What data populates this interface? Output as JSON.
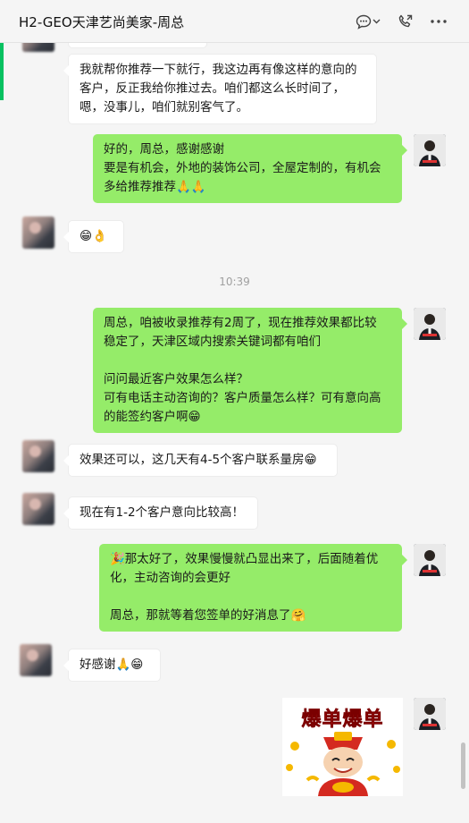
{
  "window": {
    "title": "H2-GEO天津艺尚美家-周总"
  },
  "timestamps": [
    "10:39"
  ],
  "messages": [
    {
      "id": "m1",
      "side": "in",
      "text": "我就帮你推荐一下就行，我这边再有像这样的意向的\n客户，反正我给你推过去。咱们都这么长时间了，\n嗯，没事儿，咱们就别客气了。"
    },
    {
      "id": "m2",
      "side": "out",
      "text": "好的，周总，感谢感谢\n要是有机会，外地的装饰公司，全屋定制的，有机会\n多给推荐推荐🙏🙏"
    },
    {
      "id": "m3",
      "side": "in",
      "text": "😁👌"
    },
    {
      "id": "m4",
      "side": "out",
      "text": "周总，咱被收录推荐有2周了，现在推荐效果都比较\n稳定了，天津区域内搜索关键词都有咱们\n\n问问最近客户效果怎么样？\n可有电话主动咨询的？客户质量怎么样？可有意向高\n的能签约客户啊😁"
    },
    {
      "id": "m5",
      "side": "in",
      "text": "效果还可以，这几天有4-5个客户联系量房😁"
    },
    {
      "id": "m6",
      "side": "in",
      "text": "现在有1-2个客户意向比较高！"
    },
    {
      "id": "m7",
      "side": "out",
      "text": "🎉那太好了，效果慢慢就凸显出来了，后面随着优\n化，主动咨询的会更好\n\n周总，那就等着您签单的好消息了🤗"
    },
    {
      "id": "m8",
      "side": "in",
      "text": "好感谢🙏😁"
    }
  ],
  "sticker": {
    "caption": "爆单爆单"
  },
  "icons": {
    "chat": "chat-bubble-icon",
    "dropdown": "chevron-down-icon",
    "call": "phone-call-icon",
    "more": "more-dots-icon"
  },
  "colors": {
    "outgoing_bubble": "#95ec69",
    "incoming_bubble": "#ffffff",
    "accent": "#07c160"
  }
}
